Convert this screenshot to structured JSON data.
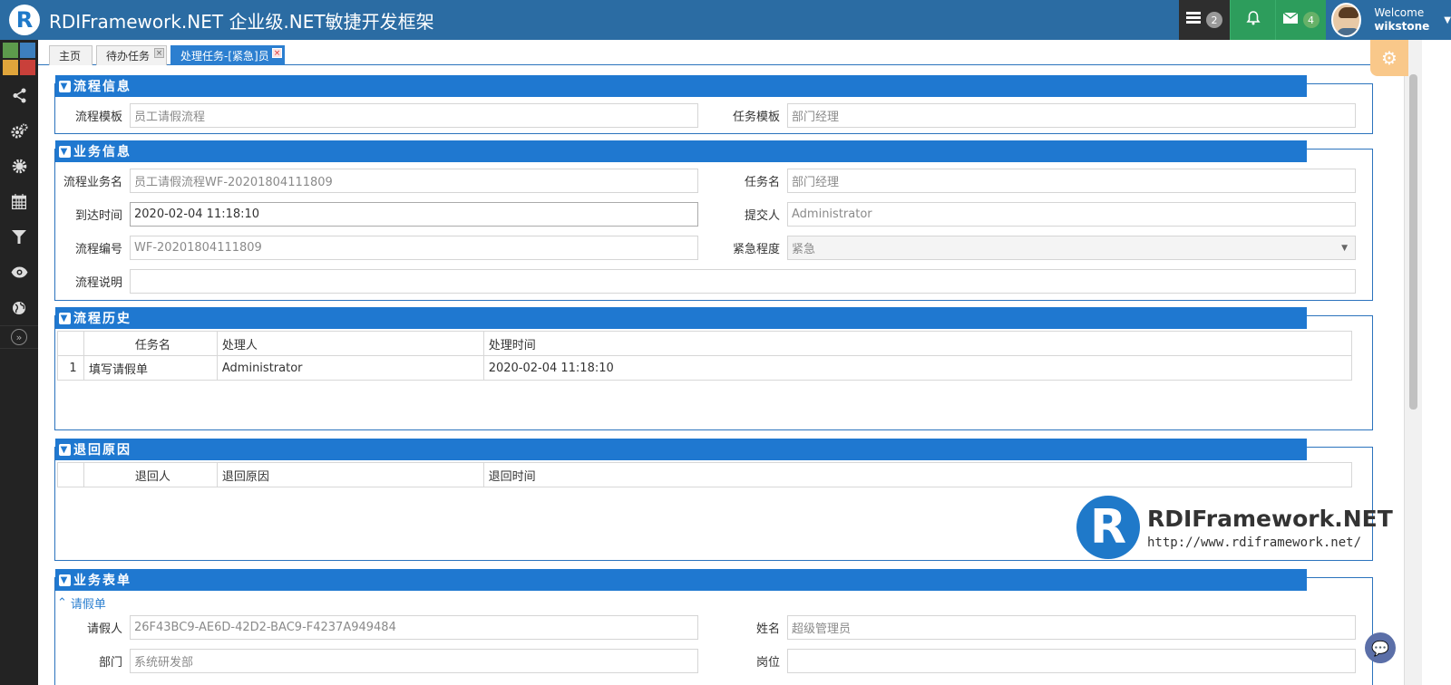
{
  "header": {
    "logo_letter": "R",
    "title": "RDIFramework.NET 企业级.NET敏捷开发框架",
    "tasks_count": "2",
    "mail_count": "4",
    "welcome": "Welcome",
    "username": "wikstone"
  },
  "sidebar": {
    "tile_colors": [
      "#5d9b4c",
      "#3d7fbd",
      "#e0a53b",
      "#c9403a"
    ],
    "icons": [
      "share-icon",
      "cogs-icon",
      "sun-gear-icon",
      "calendar-icon",
      "filter-icon",
      "eye-icon",
      "globe-icon"
    ]
  },
  "tabs": [
    {
      "label": "主页",
      "closable": false
    },
    {
      "label": "待办任务",
      "closable": true
    },
    {
      "label": "处理任务-[紧急]员",
      "closable": true,
      "active": true
    }
  ],
  "sections": {
    "flow_info": {
      "title": "流程信息",
      "template_label": "流程模板",
      "template_value": "员工请假流程",
      "task_template_label": "任务模板",
      "task_template_value": "部门经理"
    },
    "business_info": {
      "title": "业务信息",
      "biz_name_label": "流程业务名",
      "biz_name_value": "员工请假流程WF-20201804111809",
      "task_name_label": "任务名",
      "task_name_value": "部门经理",
      "arrive_label": "到达时间",
      "arrive_value": "2020-02-04 11:18:10",
      "submitter_label": "提交人",
      "submitter_value": "Administrator",
      "code_label": "流程编号",
      "code_value": "WF-20201804111809",
      "urgency_label": "紧急程度",
      "urgency_value": "紧急",
      "desc_label": "流程说明",
      "desc_value": ""
    },
    "history": {
      "title": "流程历史",
      "columns": [
        "任务名",
        "处理人",
        "处理时间"
      ],
      "rows": [
        {
          "no": "1",
          "task": "填写请假单",
          "handler": "Administrator",
          "time": "2020-02-04 11:18:10"
        }
      ]
    },
    "return_reason": {
      "title": "退回原因",
      "columns": [
        "退回人",
        "退回原因",
        "退回时间"
      ]
    },
    "business_form": {
      "title": "业务表单",
      "sub_title": "请假单",
      "applicant_label": "请假人",
      "applicant_value": "26F43BC9-AE6D-42D2-BAC9-F4237A949484",
      "name_label": "姓名",
      "name_value": "超级管理员",
      "dept_label": "部门",
      "dept_value": "系统研发部",
      "post_label": "岗位",
      "post_value": ""
    }
  },
  "watermark": {
    "title": "RDIFramework.NET",
    "url": "http://www.rdiframework.net/"
  },
  "colors": {
    "header_bg": "#2b6ca3",
    "section_head": "#1f78d0",
    "active_tab": "#2c7fd0",
    "green_btn": "#2d9d5c",
    "gear_tab": "#f9c88a"
  }
}
